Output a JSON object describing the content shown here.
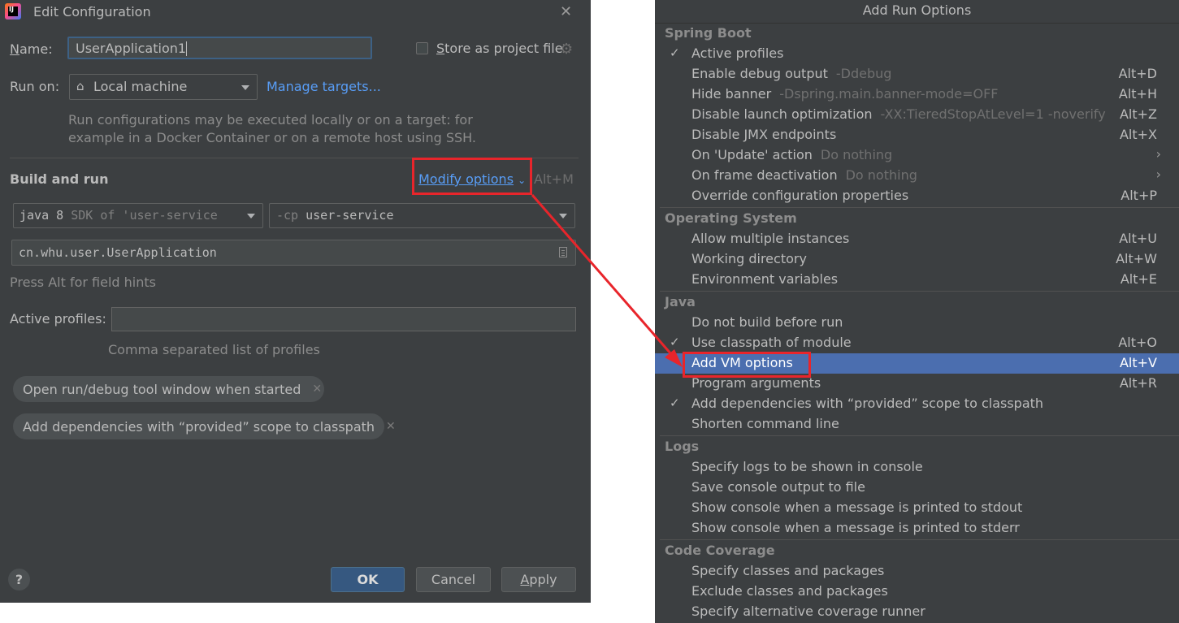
{
  "dialog": {
    "title": "Edit Configuration",
    "name_label": "Name:",
    "name_value": "UserApplication1",
    "store_label": "Store as project file",
    "run_on_label": "Run on:",
    "run_on_value": "Local machine",
    "manage_targets": "Manage targets...",
    "run_hint_line1": "Run configurations may be executed locally or on a target: for",
    "run_hint_line2": "example in a Docker Container or on a remote host using SSH.",
    "build_run_title": "Build and run",
    "modify_options": "Modify options",
    "modify_shortcut": "Alt+M",
    "sdk_main": "java 8",
    "sdk_dim": "SDK of 'user-service",
    "cp_flag": "-cp",
    "cp_value": "user-service",
    "main_class": "cn.whu.user.UserApplication",
    "field_hint": "Press Alt for field hints",
    "active_profiles_label": "Active profiles:",
    "active_profiles_value": "",
    "profiles_hint": "Comma separated list of profiles",
    "chips": [
      "Open run/debug tool window when started",
      "Add dependencies with “provided” scope to classpath"
    ],
    "help": "?",
    "ok": "OK",
    "cancel": "Cancel",
    "apply": "Apply"
  },
  "popup": {
    "title": "Add Run Options",
    "sections": [
      {
        "title": "Spring Boot",
        "items": [
          {
            "check": "✓",
            "label": "Active profiles",
            "hint": "",
            "shortcut": ""
          },
          {
            "check": "",
            "label": "Enable debug output",
            "hint": "-Ddebug",
            "shortcut": "Alt+D"
          },
          {
            "check": "",
            "label": "Hide banner",
            "hint": "-Dspring.main.banner-mode=OFF",
            "shortcut": "Alt+H"
          },
          {
            "check": "",
            "label": "Disable launch optimization",
            "hint": "-XX:TieredStopAtLevel=1 -noverify",
            "shortcut": "Alt+Z"
          },
          {
            "check": "",
            "label": "Disable JMX endpoints",
            "hint": "",
            "shortcut": "Alt+X"
          },
          {
            "check": "",
            "label": "On 'Update' action",
            "hint": "Do nothing",
            "shortcut": "",
            "submenu": "›"
          },
          {
            "check": "",
            "label": "On frame deactivation",
            "hint": "Do nothing",
            "shortcut": "",
            "submenu": "›"
          },
          {
            "check": "",
            "label": "Override configuration properties",
            "hint": "",
            "shortcut": "Alt+P"
          }
        ]
      },
      {
        "title": "Operating System",
        "items": [
          {
            "check": "",
            "label": "Allow multiple instances",
            "hint": "",
            "shortcut": "Alt+U"
          },
          {
            "check": "",
            "label": "Working directory",
            "hint": "",
            "shortcut": "Alt+W"
          },
          {
            "check": "",
            "label": "Environment variables",
            "hint": "",
            "shortcut": "Alt+E"
          }
        ]
      },
      {
        "title": "Java",
        "items": [
          {
            "check": "",
            "label": "Do not build before run",
            "hint": "",
            "shortcut": ""
          },
          {
            "check": "✓",
            "label": "Use classpath of module",
            "hint": "",
            "shortcut": "Alt+O"
          },
          {
            "check": "",
            "label": "Add VM options",
            "hint": "",
            "shortcut": "Alt+V",
            "selected": true
          },
          {
            "check": "",
            "label": "Program arguments",
            "hint": "",
            "shortcut": "Alt+R"
          },
          {
            "check": "✓",
            "label": "Add dependencies with “provided” scope to classpath",
            "hint": "",
            "shortcut": ""
          },
          {
            "check": "",
            "label": "Shorten command line",
            "hint": "",
            "shortcut": ""
          }
        ]
      },
      {
        "title": "Logs",
        "items": [
          {
            "check": "",
            "label": "Specify logs to be shown in console",
            "hint": "",
            "shortcut": ""
          },
          {
            "check": "",
            "label": "Save console output to file",
            "hint": "",
            "shortcut": ""
          },
          {
            "check": "",
            "label": "Show console when a message is printed to stdout",
            "hint": "",
            "shortcut": ""
          },
          {
            "check": "",
            "label": "Show console when a message is printed to stderr",
            "hint": "",
            "shortcut": ""
          }
        ]
      },
      {
        "title": "Code Coverage",
        "items": [
          {
            "check": "",
            "label": "Specify classes and packages",
            "hint": "",
            "shortcut": ""
          },
          {
            "check": "",
            "label": "Exclude classes and packages",
            "hint": "",
            "shortcut": ""
          },
          {
            "check": "",
            "label": "Specify alternative coverage runner",
            "hint": "",
            "shortcut": ""
          }
        ]
      }
    ]
  },
  "colors": {
    "dialog_bg": "#3c3f41",
    "accent_link": "#589df6",
    "selection": "#4b6eaf",
    "annotation_red": "#e8252b"
  }
}
